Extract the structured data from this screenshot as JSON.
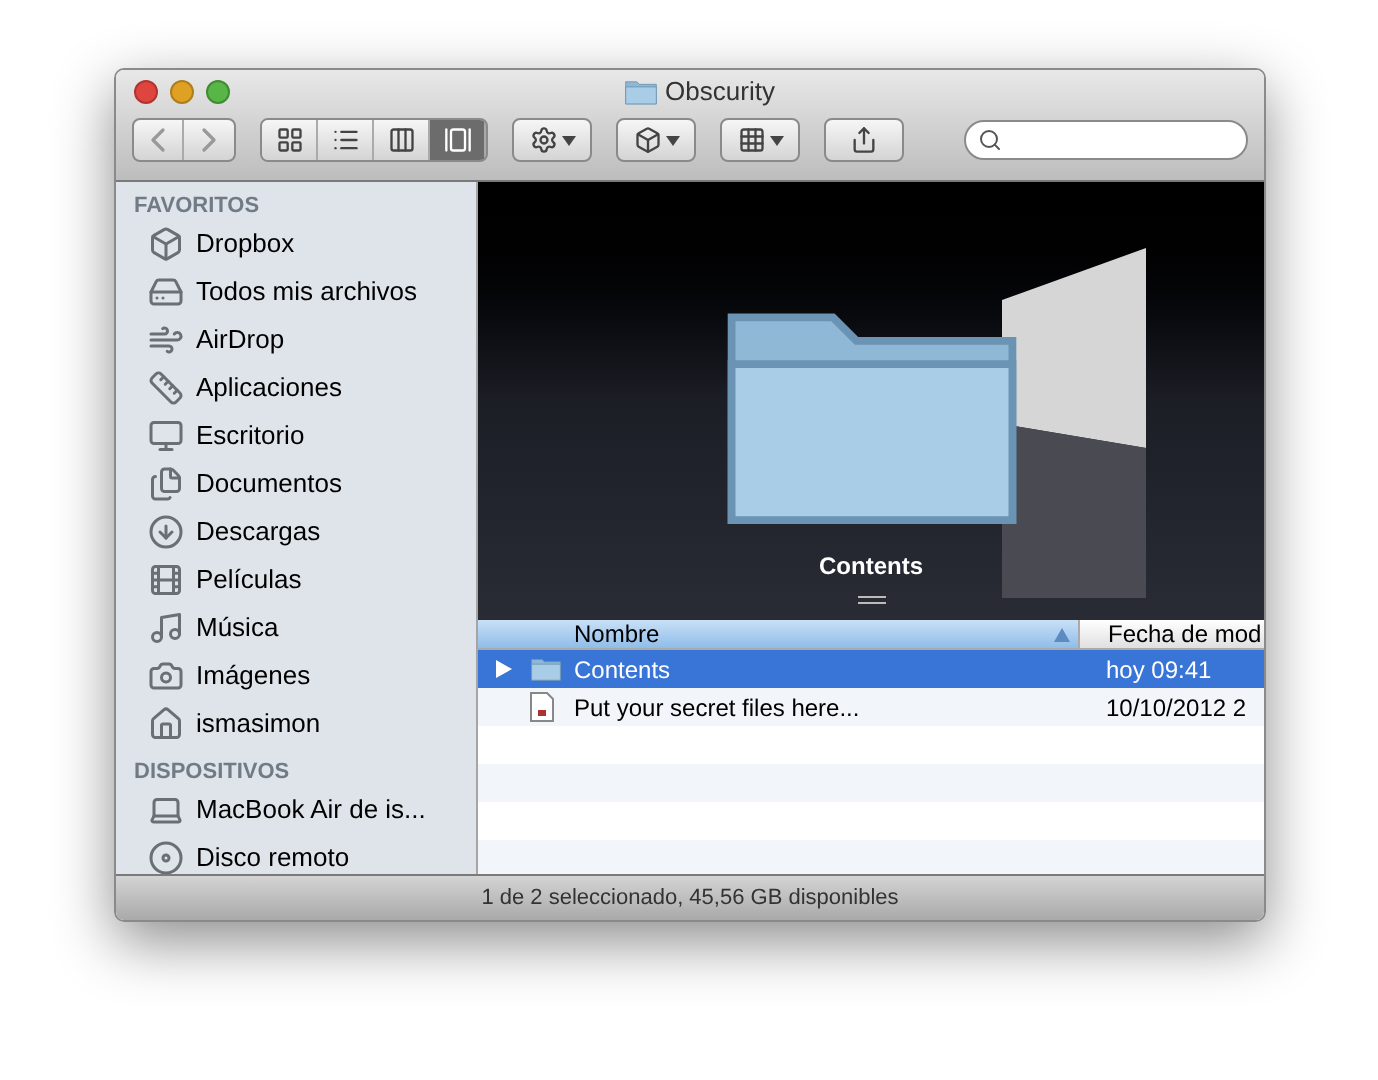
{
  "window": {
    "title": "Obscurity"
  },
  "toolbar": {
    "views": [
      {
        "kind": "icons",
        "selected": false
      },
      {
        "kind": "list",
        "selected": false
      },
      {
        "kind": "columns",
        "selected": false
      },
      {
        "kind": "coverflow",
        "selected": true
      }
    ]
  },
  "sidebar": {
    "sections": [
      {
        "heading": "FAVORITOS",
        "items": [
          {
            "kind": "dropbox",
            "label": "Dropbox"
          },
          {
            "kind": "allfiles",
            "label": "Todos mis archivos"
          },
          {
            "kind": "airdrop",
            "label": "AirDrop"
          },
          {
            "kind": "apps",
            "label": "Aplicaciones"
          },
          {
            "kind": "desktop",
            "label": "Escritorio"
          },
          {
            "kind": "documents",
            "label": "Documentos"
          },
          {
            "kind": "downloads",
            "label": "Descargas"
          },
          {
            "kind": "movies",
            "label": "Películas"
          },
          {
            "kind": "music",
            "label": "Música"
          },
          {
            "kind": "pictures",
            "label": "Imágenes"
          },
          {
            "kind": "home",
            "label": "ismasimon"
          }
        ]
      },
      {
        "heading": "DISPOSITIVOS",
        "items": [
          {
            "kind": "laptop",
            "label": "MacBook Air de is..."
          },
          {
            "kind": "disc",
            "label": "Disco remoto"
          }
        ]
      }
    ]
  },
  "coverflow": {
    "caption": "Contents"
  },
  "list": {
    "columns": [
      {
        "label": "Nombre",
        "selected": true
      },
      {
        "label": "Fecha de mod",
        "selected": false
      }
    ],
    "rows": [
      {
        "kind": "folder",
        "name": "Contents",
        "date": "hoy 09:41",
        "selected": true,
        "expandable": true
      },
      {
        "kind": "document",
        "name": "Put your secret files here...",
        "date": "10/10/2012 2",
        "selected": false,
        "expandable": false
      }
    ]
  },
  "status_bar": "1 de 2 seleccionado, 45,56 GB disponibles"
}
